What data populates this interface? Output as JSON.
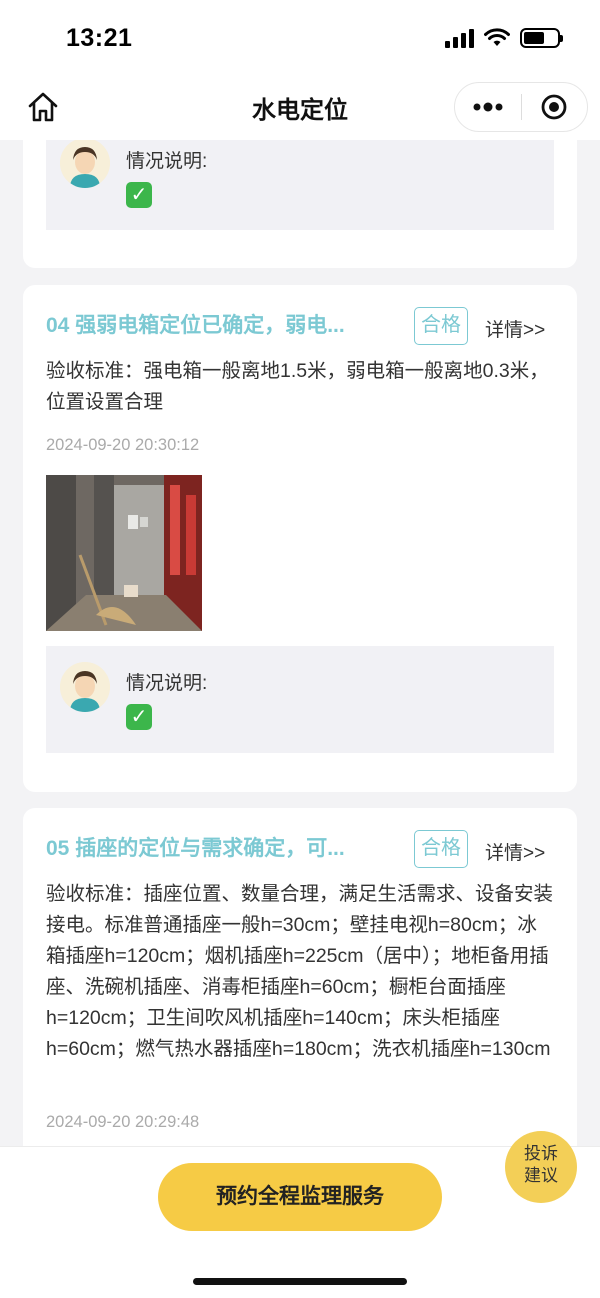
{
  "status": {
    "time": "13:21"
  },
  "nav": {
    "title": "水电定位"
  },
  "top_card": {
    "note_label": "情况说明:"
  },
  "items": [
    {
      "title": "04 强弱电箱定位已确定，弱电...",
      "badge": "合格",
      "detail": "详情>>",
      "standard": "验收标准：强电箱一般离地1.5米，弱电箱一般离地0.3米，位置设置合理",
      "time": "2024-09-20 20:30:12",
      "note_label": "情况说明:"
    },
    {
      "title": "05 插座的定位与需求确定，可...",
      "badge": "合格",
      "detail": "详情>>",
      "standard": "验收标准：插座位置、数量合理，满足生活需求、设备安装接电。标准普通插座一般h=30cm；壁挂电视h=80cm；冰箱插座h=120cm；烟机插座h=225cm（居中）；地柜备用插座、洗碗机插座、消毒柜插座h=60cm；橱柜台面插座h=120cm；卫生间吹风机插座h=140cm；床头柜插座h=60cm；燃气热水器插座h=180cm；洗衣机插座h=130cm",
      "time": "2024-09-20 20:29:48"
    }
  ],
  "bottom": {
    "book_button": "预约全程监理服务"
  },
  "float_button": {
    "line1": "投诉",
    "line2": "建议"
  },
  "colors": {
    "accent_teal": "#7cc9d3",
    "button_yellow": "#f6cb45",
    "check_green": "#3cb64b"
  },
  "icons": [
    "home-icon",
    "more-dots-icon",
    "close-target-icon",
    "signal-icon",
    "wifi-icon",
    "battery-icon",
    "avatar-icon",
    "check-icon"
  ]
}
